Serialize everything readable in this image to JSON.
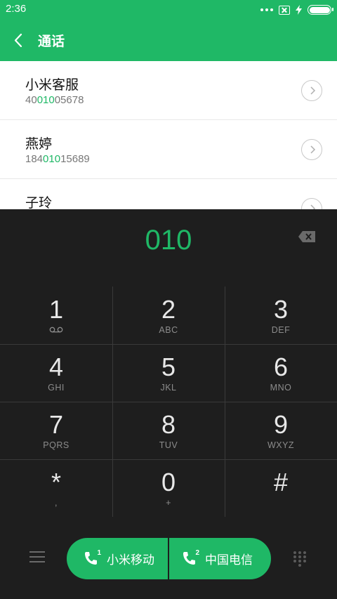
{
  "status": {
    "time": "2:36"
  },
  "header": {
    "title": "通话"
  },
  "contacts": [
    {
      "name": "小米客服",
      "number_pre": "40",
      "number_match": "010",
      "number_post": "05678"
    },
    {
      "name": "燕婷",
      "number_pre": "184",
      "number_match": "010",
      "number_post": "15689"
    },
    {
      "name": "子玲",
      "number_pre": "",
      "number_match": "",
      "number_post": ""
    }
  ],
  "dialer": {
    "number": "010"
  },
  "keypad": [
    {
      "digit": "1",
      "letters": ""
    },
    {
      "digit": "2",
      "letters": "ABC"
    },
    {
      "digit": "3",
      "letters": "DEF"
    },
    {
      "digit": "4",
      "letters": "GHI"
    },
    {
      "digit": "5",
      "letters": "JKL"
    },
    {
      "digit": "6",
      "letters": "MNO"
    },
    {
      "digit": "7",
      "letters": "PQRS"
    },
    {
      "digit": "8",
      "letters": "TUV"
    },
    {
      "digit": "9",
      "letters": "WXYZ"
    },
    {
      "digit": "*",
      "letters": ","
    },
    {
      "digit": "0",
      "letters": "+"
    },
    {
      "digit": "#",
      "letters": ""
    }
  ],
  "call_buttons": [
    {
      "label": "小米移动",
      "sim": "1"
    },
    {
      "label": "中国电信",
      "sim": "2"
    }
  ],
  "colors": {
    "accent": "#1fb866",
    "dialpad_bg": "#1e1e1e"
  },
  "icons": {
    "key_1_sub": "voicemail-icon"
  }
}
